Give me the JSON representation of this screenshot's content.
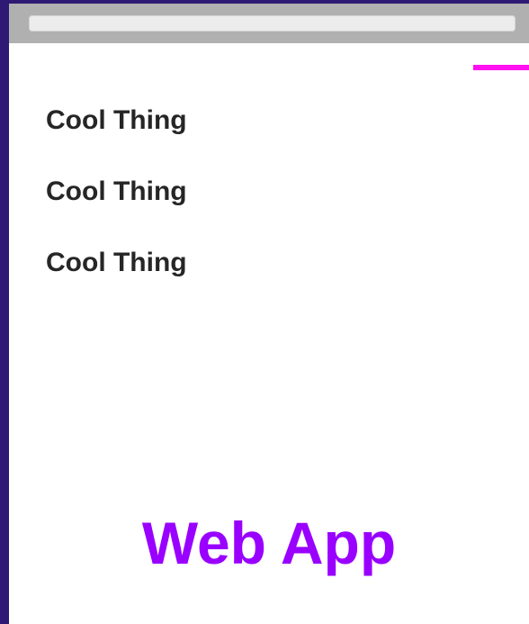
{
  "page": {
    "background_color": "#2e1a74",
    "window_background": "#ffffff",
    "topbar_color": "#b0b0b0",
    "address_bar_color": "#ececec"
  },
  "accent": {
    "color": "#ff10f0"
  },
  "items": [
    {
      "label": "Cool Thing"
    },
    {
      "label": "Cool Thing"
    },
    {
      "label": "Cool Thing"
    }
  ],
  "app": {
    "title": "Web App",
    "title_color": "#9900ff"
  }
}
